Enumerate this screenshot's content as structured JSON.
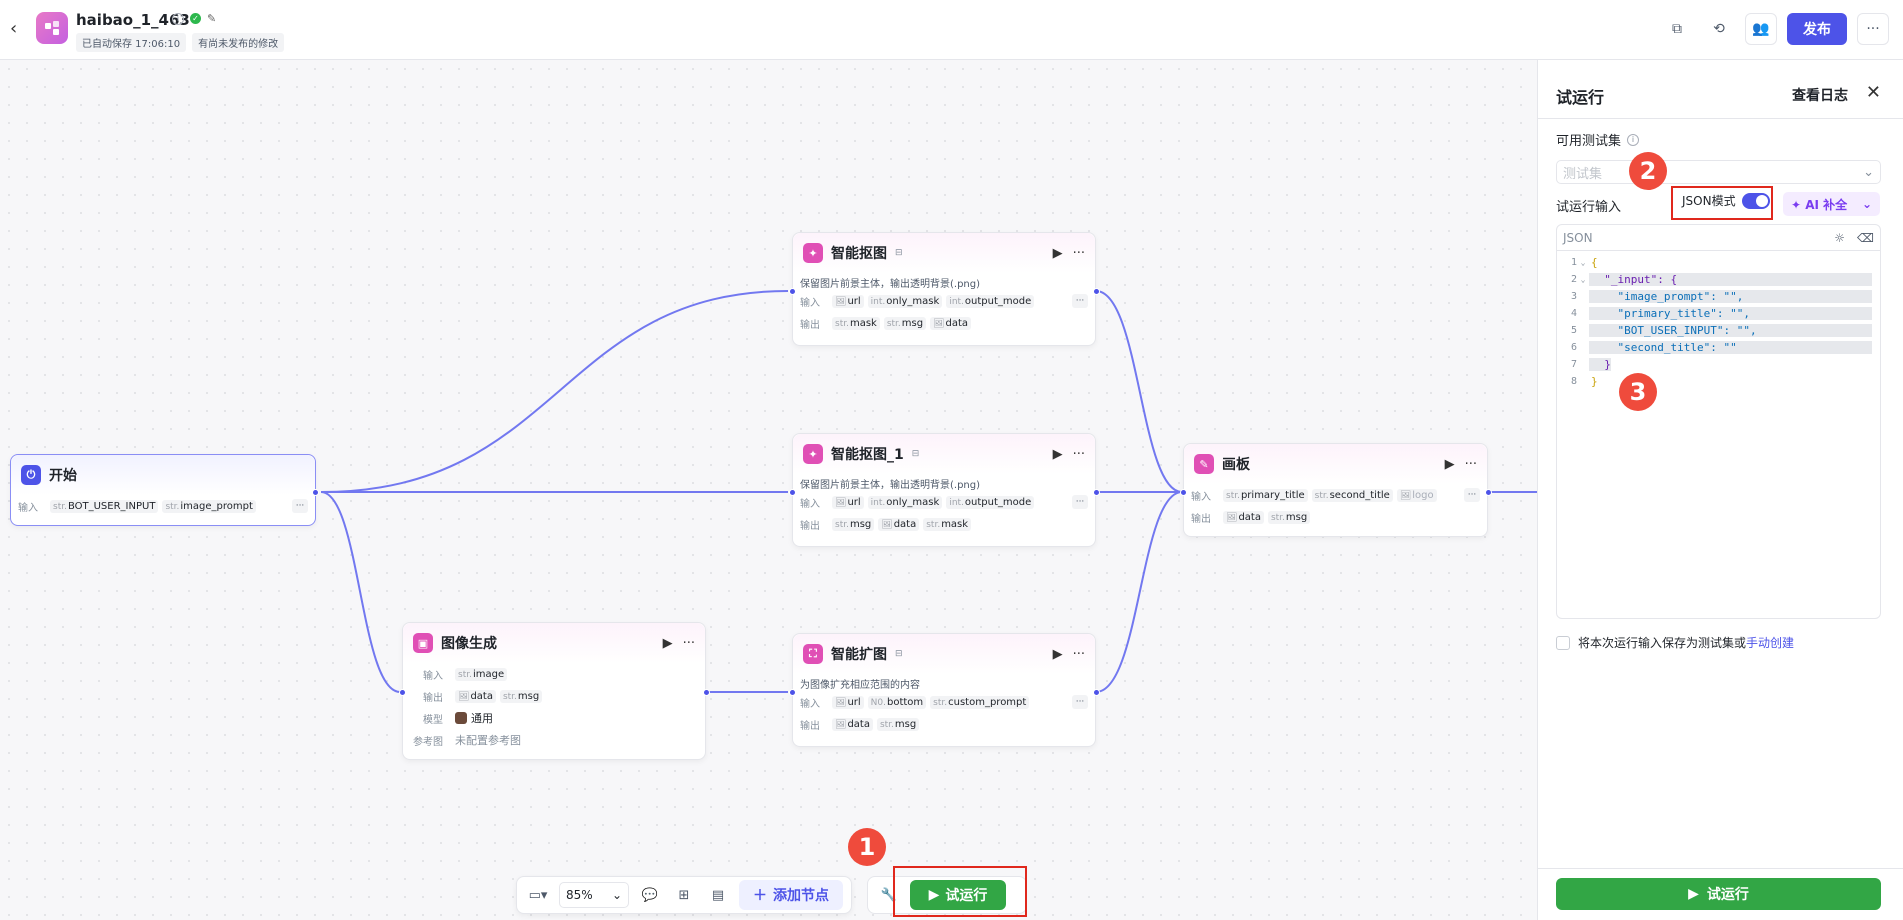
{
  "header": {
    "back_icon": "‹",
    "title": "haibao_1_463",
    "autosave": "已自动保存 17:06:10",
    "unpublished": "有尚未发布的修改",
    "publish": "发布",
    "more": "···"
  },
  "nodes": {
    "start": {
      "title": "开始",
      "input_label": "输入",
      "inputs": [
        {
          "type": "str.",
          "name": "BOT_USER_INPUT"
        },
        {
          "type": "str.",
          "name": "image_prompt"
        }
      ]
    },
    "cutout": {
      "title": "智能抠图",
      "desc": "保留图片前景主体，输出透明背景(.png)",
      "input_label": "输入",
      "output_label": "输出",
      "inputs": [
        {
          "type": "",
          "name": "url"
        },
        {
          "type": "int.",
          "name": "only_mask"
        },
        {
          "type": "int.",
          "name": "output_mode"
        }
      ],
      "outputs": [
        {
          "type": "str.",
          "name": "mask"
        },
        {
          "type": "str.",
          "name": "msg"
        },
        {
          "type": "",
          "name": "data"
        }
      ]
    },
    "cutout1": {
      "title": "智能抠图_1",
      "desc": "保留图片前景主体，输出透明背景(.png)",
      "input_label": "输入",
      "output_label": "输出",
      "inputs": [
        {
          "type": "",
          "name": "url"
        },
        {
          "type": "int.",
          "name": "only_mask"
        },
        {
          "type": "int.",
          "name": "output_mode"
        }
      ],
      "outputs": [
        {
          "type": "str.",
          "name": "msg"
        },
        {
          "type": "",
          "name": "data"
        },
        {
          "type": "str.",
          "name": "mask"
        }
      ]
    },
    "imagegen": {
      "title": "图像生成",
      "input_label": "输入",
      "output_label": "输出",
      "model_label": "模型",
      "ref_label": "参考图",
      "inputs": [
        {
          "type": "str.",
          "name": "image"
        }
      ],
      "outputs": [
        {
          "type": "",
          "name": "data"
        },
        {
          "type": "str.",
          "name": "msg"
        }
      ],
      "model": "通用",
      "ref": "未配置参考图"
    },
    "expand": {
      "title": "智能扩图",
      "desc": "为图像扩充相应范围的内容",
      "input_label": "输入",
      "output_label": "输出",
      "inputs": [
        {
          "type": "",
          "name": "url"
        },
        {
          "type": "N0.",
          "name": "bottom"
        },
        {
          "type": "str.",
          "name": "custom_prompt"
        }
      ],
      "outputs": [
        {
          "type": "",
          "name": "data"
        },
        {
          "type": "str.",
          "name": "msg"
        }
      ]
    },
    "canvas": {
      "title": "画板",
      "input_label": "输入",
      "output_label": "输出",
      "inputs": [
        {
          "type": "str.",
          "name": "primary_title"
        },
        {
          "type": "str.",
          "name": "second_title"
        },
        {
          "type": "",
          "name": "logo"
        }
      ],
      "outputs": [
        {
          "type": "",
          "name": "data"
        },
        {
          "type": "str.",
          "name": "msg"
        }
      ]
    }
  },
  "toolbar": {
    "zoom": "85%",
    "add_node": "添加节点",
    "run": "试运行"
  },
  "panel": {
    "title": "试运行",
    "view_log": "查看日志",
    "testset_label": "可用测试集",
    "testset_placeholder": "测试集",
    "input_label": "试运行输入",
    "json_mode": "JSON模式",
    "json_mode_on": true,
    "ai_fill": "AI 补全",
    "editor_label": "JSON",
    "code_lines": [
      "{",
      "  \"_input\": {",
      "    \"image_prompt\": \"\",",
      "    \"primary_title\": \"\",",
      "    \"BOT_USER_INPUT\": \"\",",
      "    \"second_title\": \"\"",
      "  }",
      "}"
    ],
    "save_text": "将本次运行输入保存为测试集或",
    "save_link": "手动创建",
    "run_button": "试运行"
  },
  "annotations": [
    "1",
    "2",
    "3"
  ],
  "colors": {
    "accent": "#4d53e8",
    "run_green": "#32a645",
    "annotation_red": "#ef4b3c"
  }
}
